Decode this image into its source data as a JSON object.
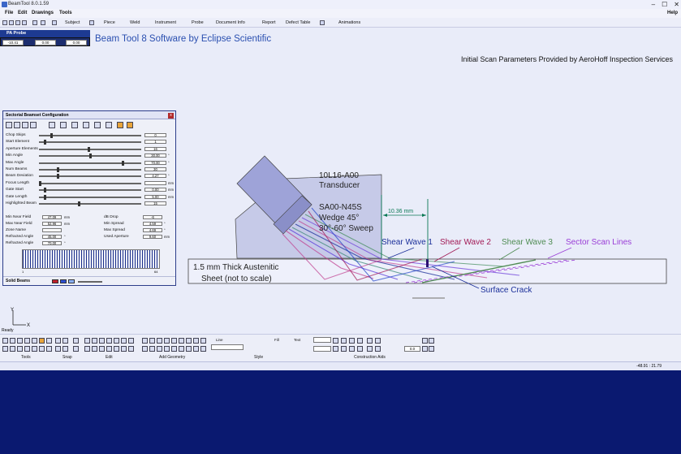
{
  "window": {
    "title": "BeamTool 8.0.1.59",
    "controls": [
      "–",
      "☐",
      "✕"
    ]
  },
  "menu": [
    "File",
    "Edit",
    "Drawings",
    "Tools"
  ],
  "menu_right": "Help",
  "toolbar": {
    "subject": "Subject",
    "piece": "Piece",
    "weld": "Weld",
    "instrument": "Instrument",
    "probe": "Probe",
    "document_info": "Document Info",
    "report": "Report",
    "defect_table": "Defect Table",
    "animations": "Animations"
  },
  "probe_panel": {
    "tab": "PA Probe",
    "field1": "-10.41",
    "field2": "0.00",
    "field3": "0.00"
  },
  "header": "Beam Tool 8 Software by Eclipse Scientific",
  "credit": "Initial Scan Parameters Provided by AeroHoff Inspection Services",
  "dialog": {
    "title": "Sectorial Beamset Configuration",
    "close": "x",
    "params": [
      {
        "label": "Chop Skips",
        "value": "0",
        "unit": "",
        "level": 0.12
      },
      {
        "label": "Start Element",
        "value": "1",
        "unit": "",
        "level": 0.05
      },
      {
        "label": "Aperture Elements",
        "value": "16",
        "unit": "",
        "level": 0.5
      },
      {
        "label": "Min Angle",
        "value": "30.00",
        "unit": "°",
        "level": 0.52
      },
      {
        "label": "Max Angle",
        "value": "70.00",
        "unit": "°",
        "level": 0.85
      },
      {
        "label": "Num Beams",
        "value": "30",
        "unit": "",
        "level": 0.18
      },
      {
        "label": "Beam Deviation",
        "value": "4.27",
        "unit": "°",
        "level": 0.18
      },
      {
        "label": "Focus Length",
        "value": "",
        "unit": "mm",
        "level": 0.0
      },
      {
        "label": "Gate Start",
        "value": "0.00",
        "unit": "mm",
        "level": 0.05
      },
      {
        "label": "Gate Length",
        "value": "5.00",
        "unit": "mm",
        "level": 0.05
      },
      {
        "label": "Highlighted Beam",
        "value": "15",
        "unit": "",
        "level": 0.4
      }
    ],
    "left_fields": [
      {
        "label": "Min Near Field",
        "value": "47.09",
        "unit": "mm"
      },
      {
        "label": "Max Near Field",
        "value": "52.96",
        "unit": "mm"
      },
      {
        "label": "Zone Name",
        "value": "",
        "unit": ""
      },
      {
        "label": "Refracted Angle",
        "value": "45.00",
        "unit": "°"
      },
      {
        "label": "Refracted Angle",
        "value": "70.00",
        "unit": "°"
      }
    ],
    "right_fields": [
      {
        "label": "dB Drop",
        "value": "-6",
        "unit": ""
      },
      {
        "label": "Min Spread",
        "value": "4.59",
        "unit": "°"
      },
      {
        "label": "Max Spread",
        "value": "4.69",
        "unit": "°"
      },
      {
        "label": "Used Aperture",
        "value": "9.60",
        "unit": "mm"
      }
    ],
    "strip_min": "1",
    "strip_max": "64",
    "solid_beams": "Solid Beams",
    "colors": [
      "#c0202b",
      "#2d4fd2",
      "#8bb2ff"
    ]
  },
  "diagram": {
    "transducer": "10L16-A00",
    "transducer2": "Transducer",
    "wedge1": "SA00-N45S",
    "wedge2": "Wedge 45°",
    "wedge3": "30°-60° Sweep",
    "dimension": "10.36 mm",
    "shear1": "Shear Wave 1",
    "shear2": "Shear Wave 2",
    "shear3": "Shear Wave 3",
    "sector": "Sector Scan Lines",
    "sheet1": "1.5 mm Thick Austenitic",
    "sheet2": "Sheet (not to scale)",
    "crack": "Surface Crack",
    "colors": {
      "shear1": "#1b2f9a",
      "shear2": "#a21a55",
      "shear3": "#4f8c53",
      "sector": "#9a3dd6",
      "dimension": "#0c7a55"
    }
  },
  "axis": {
    "y": "Y",
    "x": "X"
  },
  "status": "Ready",
  "bottom_groups": [
    "Tools",
    "Snap",
    "Edit",
    "Add Geometry",
    "Style",
    "Construction Aids"
  ],
  "bottom_labels": {
    "line": "Line",
    "fill": "Fill",
    "text": "Text",
    "scale": "0.0"
  },
  "coords": "-48.91 : 21.79"
}
